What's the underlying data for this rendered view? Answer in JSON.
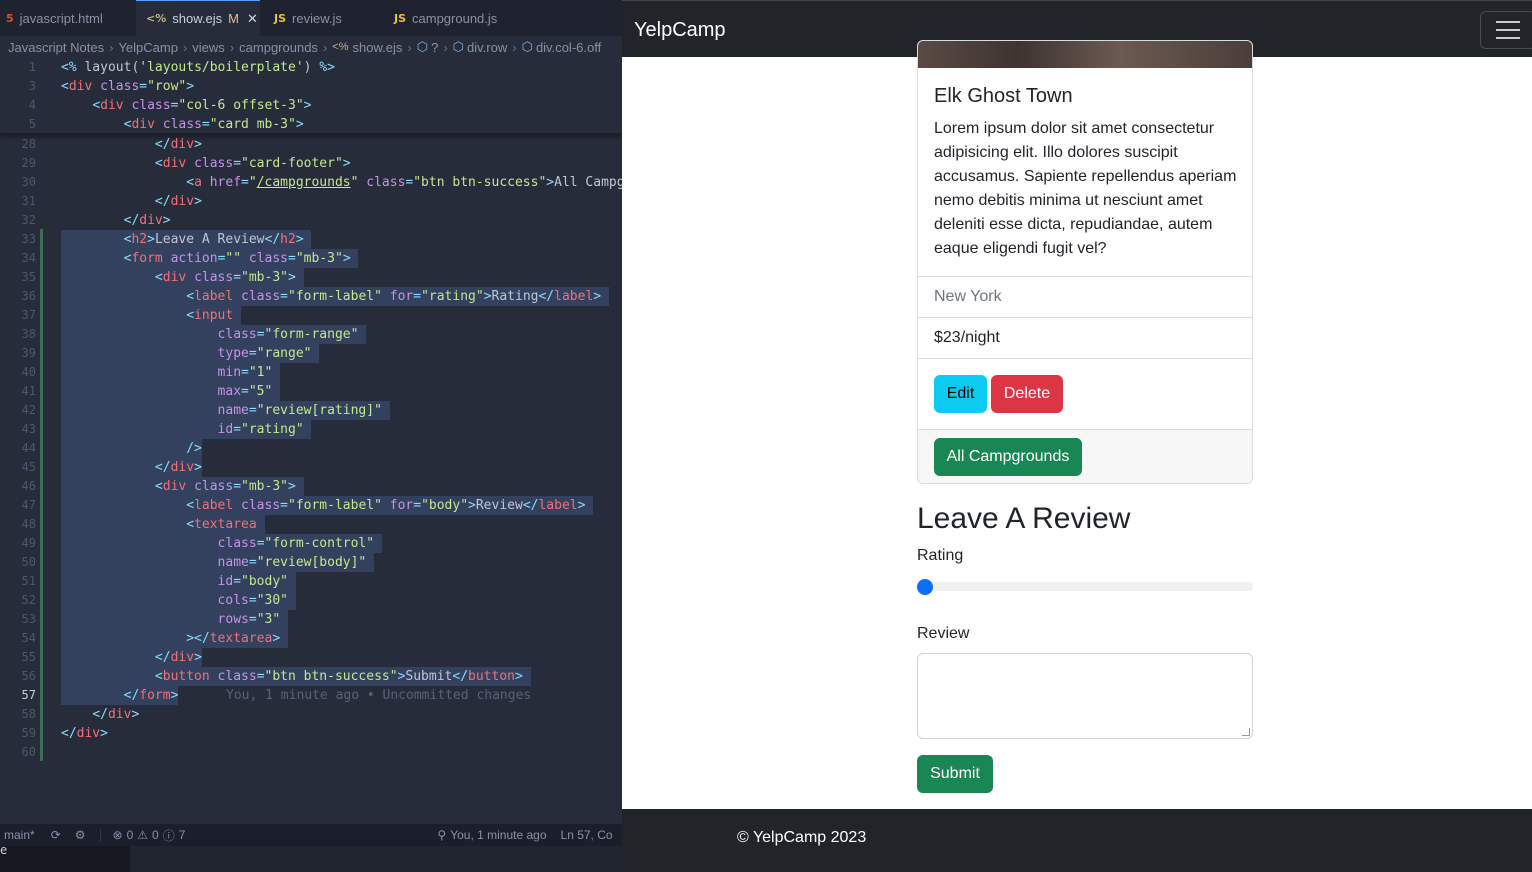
{
  "editor": {
    "tabs": [
      {
        "label": "javascript.html",
        "icon": "5"
      },
      {
        "label": "show.ejs",
        "icon": "<%",
        "modified": "M"
      },
      {
        "label": "review.js",
        "icon": "JS"
      },
      {
        "label": "campground.js",
        "icon": "JS"
      }
    ],
    "breadcrumbs": [
      "Javascript Notes",
      "YelpCamp",
      "views",
      "campgrounds",
      "show.ejs",
      "?",
      "div.row",
      "div.col-6.off"
    ],
    "line_numbers": [
      "1",
      "3",
      "4",
      "5",
      "28",
      "29",
      "30",
      "31",
      "32",
      "33",
      "34",
      "35",
      "36",
      "37",
      "38",
      "39",
      "40",
      "41",
      "42",
      "43",
      "44",
      "45",
      "46",
      "47",
      "48",
      "49",
      "50",
      "51",
      "52",
      "53",
      "54",
      "55",
      "56",
      "57",
      "58",
      "59",
      "60"
    ],
    "blame": "You, 1 minute ago • Uncommitted changes",
    "status": {
      "branch": "main*",
      "errors": "0",
      "warnings": "0",
      "info": "7",
      "blame": "You, 1 minute ago",
      "position": "Ln 57, Co"
    },
    "terminal_prompt": "e"
  },
  "browser": {
    "brand": "YelpCamp",
    "card": {
      "title": "Elk Ghost Town",
      "description": "Lorem ipsum dolor sit amet consectetur adipisicing elit. Illo dolores suscipit accusamus. Sapiente repellendus aperiam nemo debitis minima ut nesciunt amet deleniti esse dicta, repudiandae, autem eaque eligendi fugit vel?",
      "location": "New York",
      "price": "$23/night",
      "edit_label": "Edit",
      "delete_label": "Delete",
      "all_label": "All Campgrounds"
    },
    "review": {
      "heading": "Leave A Review",
      "rating_label": "Rating",
      "rating_value": 1,
      "rating_min": 1,
      "rating_max": 5,
      "review_label": "Review",
      "submit_label": "Submit"
    },
    "footer": "© YelpCamp 2023",
    "colors": {
      "edit": "#0dcaf0",
      "delete": "#dc3545",
      "success": "#198754",
      "range": "#0d6efd",
      "navbar": "#212529"
    }
  }
}
